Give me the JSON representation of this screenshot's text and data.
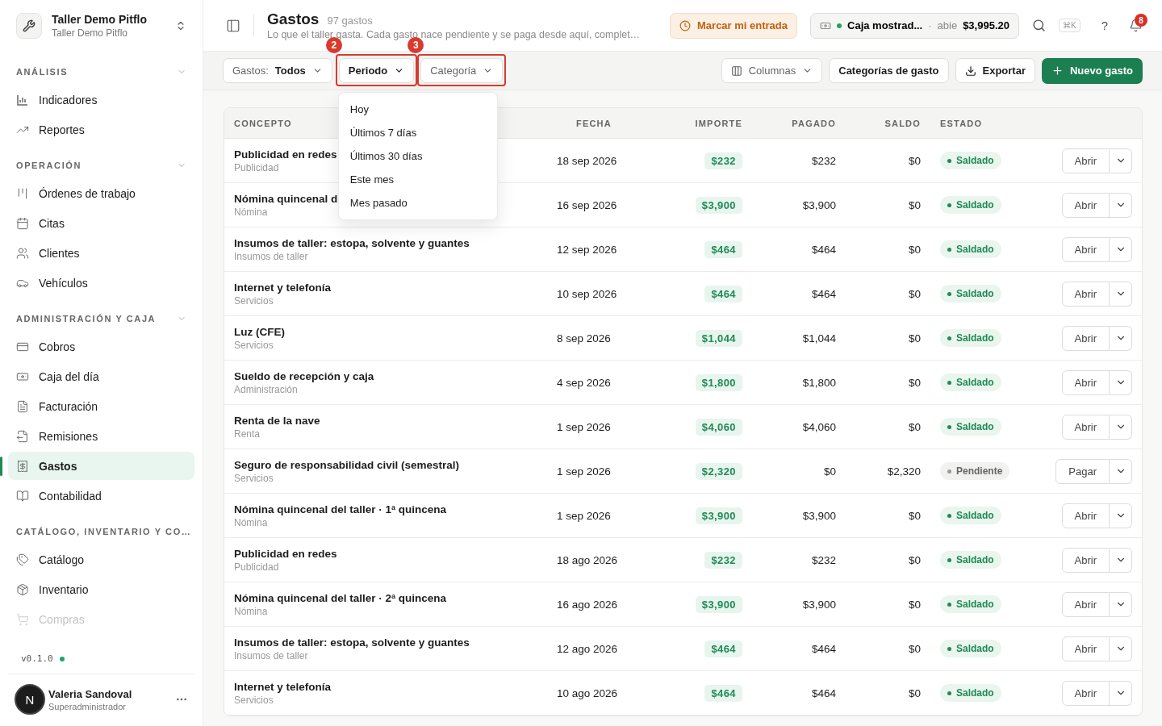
{
  "workspace": {
    "name": "Taller Demo Pitflo",
    "subtitle": "Taller Demo Pitflo"
  },
  "sidebar": {
    "sections": [
      {
        "title": "ANÁLISIS",
        "items": [
          {
            "label": "Indicadores",
            "selected": false
          },
          {
            "label": "Reportes",
            "selected": false
          }
        ]
      },
      {
        "title": "OPERACIÓN",
        "items": [
          {
            "label": "Órdenes de trabajo",
            "selected": false
          },
          {
            "label": "Citas",
            "selected": false
          },
          {
            "label": "Clientes",
            "selected": false
          },
          {
            "label": "Vehículos",
            "selected": false
          }
        ]
      },
      {
        "title": "ADMINISTRACIÓN Y CAJA",
        "items": [
          {
            "label": "Cobros",
            "selected": false
          },
          {
            "label": "Caja del día",
            "selected": false
          },
          {
            "label": "Facturación",
            "selected": false
          },
          {
            "label": "Remisiones",
            "selected": false
          },
          {
            "label": "Gastos",
            "selected": true
          },
          {
            "label": "Contabilidad",
            "selected": false
          }
        ]
      },
      {
        "title": "CATÁLOGO, INVENTARIO Y CO…",
        "items": [
          {
            "label": "Catálogo",
            "selected": false
          },
          {
            "label": "Inventario",
            "selected": false
          },
          {
            "label": "Compras",
            "selected": false
          }
        ]
      }
    ],
    "version": "v0.1.0",
    "user": {
      "name": "Valeria Sandoval",
      "role": "Superadministrador",
      "initial": "N"
    }
  },
  "header": {
    "title": "Gastos",
    "count": "97 gastos",
    "description": "Lo que el taller gasta. Cada gasto nace pendiente y se paga desde aquí, complet…",
    "clock_in": "Marcar mi entrada",
    "register": {
      "name": "Caja mostrad...",
      "separator": "·",
      "status": "abie",
      "amount": "$3,995.20"
    },
    "shortcut": "⌘K",
    "help": "?",
    "notifications": "8"
  },
  "toolbar": {
    "filters": [
      {
        "kind": "value",
        "label": "Gastos:",
        "value": "Todos",
        "open": false
      },
      {
        "kind": "plain",
        "label": "Periodo",
        "open": true,
        "callout": "2"
      },
      {
        "kind": "plain",
        "label": "Categoría",
        "open": false,
        "callout": "3"
      }
    ],
    "period_menu": [
      "Hoy",
      "Últimos 7 días",
      "Últimos 30 días",
      "Este mes",
      "Mes pasado"
    ],
    "columns_button": "Columnas",
    "categories_button": "Categorías de gasto",
    "export_button": "Exportar",
    "new_button": "Nuevo gasto"
  },
  "table": {
    "columns": [
      "CONCEPTO",
      "FECHA",
      "IMPORTE",
      "PAGADO",
      "SALDO",
      "ESTADO"
    ],
    "rows": [
      {
        "concept": "Publicidad en redes",
        "category": "Publicidad",
        "date": "18 sep 2026",
        "amount": "$232",
        "paid": "$232",
        "balance": "$0",
        "status": {
          "kind": "settled",
          "label": "Saldado"
        },
        "action": "Abrir"
      },
      {
        "concept": "Nómina quincenal d",
        "category": "Nómina",
        "date": "16 sep 2026",
        "amount": "$3,900",
        "paid": "$3,900",
        "balance": "$0",
        "status": {
          "kind": "settled",
          "label": "Saldado"
        },
        "action": "Abrir"
      },
      {
        "concept": "Insumos de taller: estopa, solvente y guantes",
        "category": "Insumos de taller",
        "date": "12 sep 2026",
        "amount": "$464",
        "paid": "$464",
        "balance": "$0",
        "status": {
          "kind": "settled",
          "label": "Saldado"
        },
        "action": "Abrir"
      },
      {
        "concept": "Internet y telefonía",
        "category": "Servicios",
        "date": "10 sep 2026",
        "amount": "$464",
        "paid": "$464",
        "balance": "$0",
        "status": {
          "kind": "settled",
          "label": "Saldado"
        },
        "action": "Abrir"
      },
      {
        "concept": "Luz (CFE)",
        "category": "Servicios",
        "date": "8 sep 2026",
        "amount": "$1,044",
        "paid": "$1,044",
        "balance": "$0",
        "status": {
          "kind": "settled",
          "label": "Saldado"
        },
        "action": "Abrir"
      },
      {
        "concept": "Sueldo de recepción y caja",
        "category": "Administración",
        "date": "4 sep 2026",
        "amount": "$1,800",
        "paid": "$1,800",
        "balance": "$0",
        "status": {
          "kind": "settled",
          "label": "Saldado"
        },
        "action": "Abrir"
      },
      {
        "concept": "Renta de la nave",
        "category": "Renta",
        "date": "1 sep 2026",
        "amount": "$4,060",
        "paid": "$4,060",
        "balance": "$0",
        "status": {
          "kind": "settled",
          "label": "Saldado"
        },
        "action": "Abrir"
      },
      {
        "concept": "Seguro de responsabilidad civil (semestral)",
        "category": "Servicios",
        "date": "1 sep 2026",
        "amount": "$2,320",
        "paid": "$0",
        "balance": "$2,320",
        "status": {
          "kind": "pending",
          "label": "Pendiente"
        },
        "action": "Pagar"
      },
      {
        "concept": "Nómina quincenal del taller · 1ª quincena",
        "category": "Nómina",
        "date": "1 sep 2026",
        "amount": "$3,900",
        "paid": "$3,900",
        "balance": "$0",
        "status": {
          "kind": "settled",
          "label": "Saldado"
        },
        "action": "Abrir"
      },
      {
        "concept": "Publicidad en redes",
        "category": "Publicidad",
        "date": "18 ago 2026",
        "amount": "$232",
        "paid": "$232",
        "balance": "$0",
        "status": {
          "kind": "settled",
          "label": "Saldado"
        },
        "action": "Abrir"
      },
      {
        "concept": "Nómina quincenal del taller · 2ª quincena",
        "category": "Nómina",
        "date": "16 ago 2026",
        "amount": "$3,900",
        "paid": "$3,900",
        "balance": "$0",
        "status": {
          "kind": "settled",
          "label": "Saldado"
        },
        "action": "Abrir"
      },
      {
        "concept": "Insumos de taller: estopa, solvente y guantes",
        "category": "Insumos de taller",
        "date": "12 ago 2026",
        "amount": "$464",
        "paid": "$464",
        "balance": "$0",
        "status": {
          "kind": "settled",
          "label": "Saldado"
        },
        "action": "Abrir"
      },
      {
        "concept": "Internet y telefonía",
        "category": "Servicios",
        "date": "10 ago 2026",
        "amount": "$464",
        "paid": "$464",
        "balance": "$0",
        "status": {
          "kind": "settled",
          "label": "Saldado"
        },
        "action": "Abrir"
      }
    ]
  }
}
